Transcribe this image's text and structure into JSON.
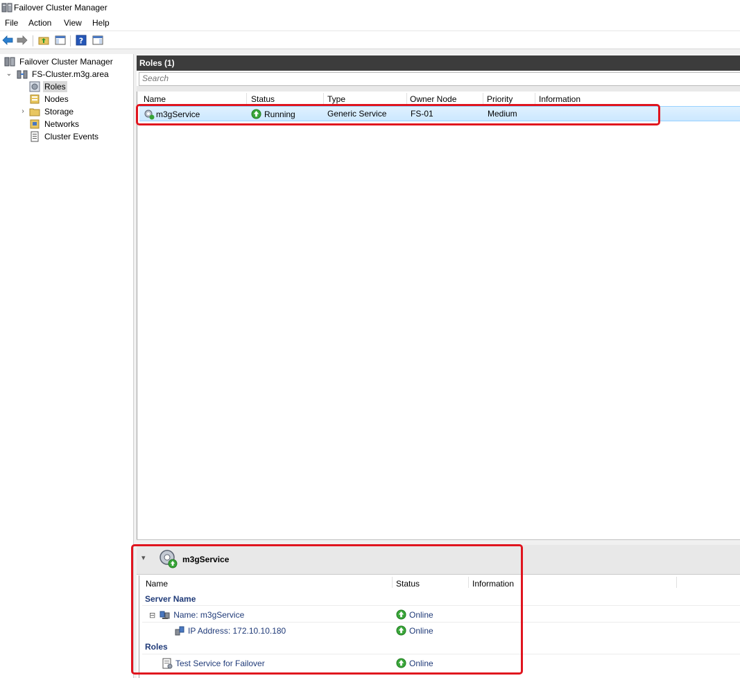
{
  "window": {
    "title": "Failover Cluster Manager"
  },
  "menu": [
    "File",
    "Action",
    "View",
    "Help"
  ],
  "toolbar": {
    "icons": [
      "back-arrow-icon",
      "forward-arrow-icon",
      "up-folder-icon",
      "show-hide-tree-icon",
      "help-icon",
      "action-pane-icon"
    ]
  },
  "tree": {
    "root": "Failover Cluster Manager",
    "cluster": "FS-Cluster.m3g.area",
    "items": [
      {
        "label": "Roles",
        "selected": true
      },
      {
        "label": "Nodes"
      },
      {
        "label": "Storage",
        "expandable": true
      },
      {
        "label": "Networks"
      },
      {
        "label": "Cluster Events"
      }
    ]
  },
  "roles": {
    "title": "Roles (1)",
    "search_placeholder": "Search",
    "columns": [
      "Name",
      "Status",
      "Type",
      "Owner Node",
      "Priority",
      "Information"
    ],
    "rows": [
      {
        "name": "m3gService",
        "status": "Running",
        "type": "Generic Service",
        "owner": "FS-01",
        "priority": "Medium",
        "information": ""
      }
    ]
  },
  "details": {
    "title": "m3gService",
    "columns": [
      "Name",
      "Status",
      "Information"
    ],
    "groups": [
      {
        "label": "Server Name",
        "items": [
          {
            "label": "Name: m3gService",
            "status": "Online",
            "collapse": "⊟"
          },
          {
            "label": "IP Address: 172.10.10.180",
            "status": "Online"
          }
        ]
      },
      {
        "label": "Roles",
        "items": [
          {
            "label": "Test Service for Failover",
            "status": "Online"
          }
        ]
      }
    ]
  },
  "colors": {
    "highlight": "#e0141e",
    "selection": "#cce8ff",
    "header_dark": "#3c3c3c",
    "group_text": "#1f3a78"
  }
}
